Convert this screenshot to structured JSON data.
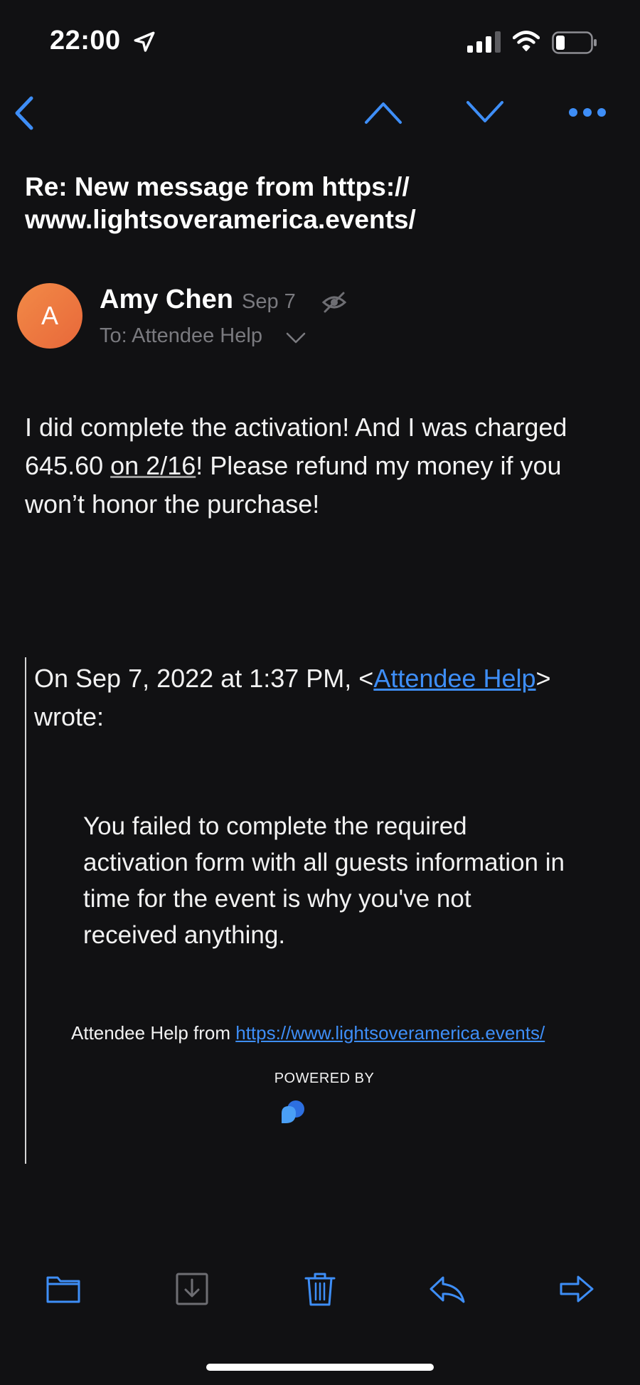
{
  "status_bar": {
    "time": "22:00",
    "icons": [
      "location-arrow-icon",
      "signal-icon",
      "wifi-icon",
      "battery-icon"
    ]
  },
  "nav": {
    "icons": [
      "back-chevron-icon",
      "previous-message-icon",
      "next-message-icon",
      "more-options-icon"
    ]
  },
  "email": {
    "subject": "Re: New message from https:// www.lightsoveramerica.events/",
    "sender": {
      "avatar_letter": "A",
      "name": "Amy Chen",
      "date": "Sep 7",
      "to": "To: Attendee Help"
    },
    "body": {
      "part1": "I did complete the activation! And I was charged 645.60 ",
      "underlined": "on 2/16",
      "part2": "! Please refund my money if you won’t honor the purchase!"
    },
    "quote": {
      "intro_prefix": "On Sep 7, 2022 at 1:37 PM, <",
      "intro_link": "Attendee Help",
      "intro_suffix": "> wrote:",
      "message": "You failed to complete the required activation form with all guests information in time for the event is why you've not received anything.",
      "footer_prefix": "Attendee Help from ",
      "footer_link": "https://www.lightsoveramerica.events/",
      "powered_by": "POWERED BY"
    }
  },
  "toolbar": {
    "icons": [
      "folder-icon",
      "archive-icon",
      "trash-icon",
      "reply-icon",
      "forward-icon"
    ]
  },
  "colors": {
    "accent": "#3e8ef7",
    "background": "#111113",
    "avatar": "#ee7640"
  }
}
